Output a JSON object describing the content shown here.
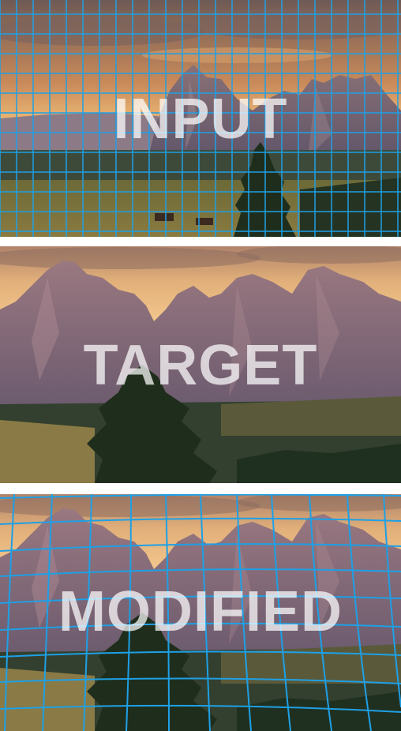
{
  "panels": [
    {
      "label": "INPUT"
    },
    {
      "label": "TARGET"
    },
    {
      "label": "MODIFIED"
    }
  ],
  "colors": {
    "grid": "#1ea0e6",
    "background": "#ffffff",
    "label": "rgba(255,255,255,0.72)"
  },
  "icons": {
    "scene": "mountain-landscape-photo"
  }
}
